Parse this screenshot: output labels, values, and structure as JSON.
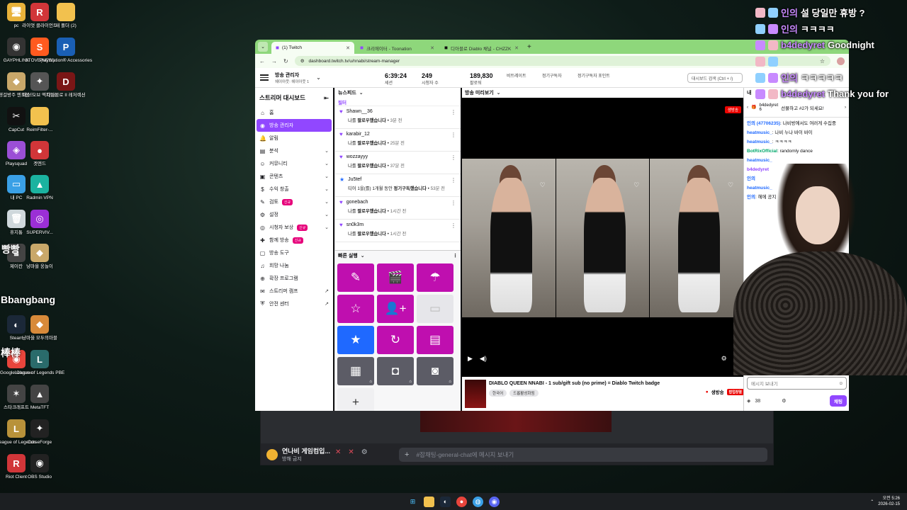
{
  "desktop": {
    "icons": [
      {
        "label": "pc",
        "glyph": "🖥",
        "color": "#e8b23a"
      },
      {
        "label": "라이엇 클라이언트",
        "glyph": "R",
        "color": "#d13639"
      },
      {
        "label": "새 폴더 (2)",
        "glyph": "",
        "color": "#f2c14e"
      },
      {
        "label": "GAYPHLINK",
        "glyph": "◉",
        "color": "#333"
      },
      {
        "label": "STOVE(NEW)",
        "glyph": "S",
        "color": "#ff5a1f"
      },
      {
        "label": "PlayStation® Accessories",
        "glyph": "P",
        "color": "#1a5fb4"
      },
      {
        "label": "영걸방주 엔드필드",
        "glyph": "◆",
        "color": "#c9a86a"
      },
      {
        "label": "패스 오브 엑자일2",
        "glyph": "✦",
        "color": "#555"
      },
      {
        "label": "디아블로 II 레저렉션",
        "glyph": "D",
        "color": "#7a1616"
      },
      {
        "label": "CapCut",
        "glyph": "✂",
        "color": "#111"
      },
      {
        "label": "ReimFilter-...",
        "glyph": "",
        "color": "#f2c14e"
      },
      {
        "label": "Playsquad",
        "glyph": "◈",
        "color": "#9b4fd6"
      },
      {
        "label": "겟엔드",
        "glyph": "●",
        "color": "#d13639"
      },
      {
        "label": "내 PC",
        "glyph": "▭",
        "color": "#3aa0e6"
      },
      {
        "label": "Radmin VPN",
        "glyph": "▲",
        "color": "#1bb3a0"
      },
      {
        "label": "휴지통",
        "glyph": "🗑",
        "color": "#cfd8dc"
      },
      {
        "label": "SUPERVIV...",
        "glyph": "◎",
        "color": "#9b2fd6"
      },
      {
        "label": "제이칸",
        "glyph": "■",
        "color": "#444"
      },
      {
        "label": "냥마을 웅놀이",
        "glyph": "◆",
        "color": "#c9a86a"
      },
      {
        "label": "Steam",
        "glyph": "◐",
        "color": "#1b2838"
      },
      {
        "label": "냥마을 모두의마블",
        "glyph": "◆",
        "color": "#d88a3a"
      },
      {
        "label": "Google Chrome",
        "glyph": "◉",
        "color": "#e8453c"
      },
      {
        "label": "League of Legends PBE",
        "glyph": "L",
        "color": "#2a6b6b"
      },
      {
        "label": "스타크래프트",
        "glyph": "✶",
        "color": "#444"
      },
      {
        "label": "MetaTFT",
        "glyph": "▲",
        "color": "#444"
      },
      {
        "label": "League of Legends",
        "glyph": "L",
        "color": "#b8923a"
      },
      {
        "label": "CurseForge",
        "glyph": "✦",
        "color": "#222"
      },
      {
        "label": "Riot Client",
        "glyph": "R",
        "color": "#d13639"
      },
      {
        "label": "OBS Studio",
        "glyph": "◉",
        "color": "#222"
      }
    ],
    "big_label_1": "빵빵",
    "big_label_2": "Bbangbang",
    "big_label_3": "棒棒"
  },
  "discord": {
    "username": "연나비 게임컴입...",
    "user_status": "방해 금지",
    "chat_placeholder": "#잡채팅-general-chat에 메시지 보내기"
  },
  "browser": {
    "tabs": [
      {
        "title": "(1) Twitch",
        "active": true
      },
      {
        "title": "크리에이터 - Toonation",
        "active": false
      },
      {
        "title": "디아블로 Diablo 채널 - CHZZK",
        "active": false
      }
    ],
    "url": "dashboard.twitch.tv/u/nnabi/stream-manager"
  },
  "twitch": {
    "channel_title": "방송 관리자",
    "channel_sub": "쉐이아웃: 쉐이아웃 1",
    "stats": [
      {
        "value": "6:39:24",
        "label": "세션"
      },
      {
        "value": "249",
        "label": "시청자 수"
      },
      {
        "value": "189,830",
        "label": "팔로워"
      },
      {
        "value": "",
        "label": "비트레이트"
      },
      {
        "value": "",
        "label": "정기구독자"
      },
      {
        "value": "",
        "label": "정기구독자 포인트"
      }
    ],
    "search_placeholder": "대시보드 검색 (Ctrl + /)",
    "sidebar_title": "스트리머 대시보드",
    "sidebar": [
      {
        "icon": "⌂",
        "label": "홈",
        "chev": "",
        "new": false,
        "ext": false,
        "active": false
      },
      {
        "icon": "◉",
        "label": "방송 관리자",
        "chev": "",
        "new": false,
        "ext": false,
        "active": true
      },
      {
        "icon": "🔔",
        "label": "알림",
        "chev": "",
        "new": false,
        "ext": false,
        "active": false
      },
      {
        "icon": "▤",
        "label": "분석",
        "chev": "⌄",
        "new": false,
        "ext": false,
        "active": false
      },
      {
        "icon": "☺",
        "label": "커뮤니티",
        "chev": "⌄",
        "new": false,
        "ext": false,
        "active": false
      },
      {
        "icon": "▣",
        "label": "콘텐츠",
        "chev": "⌄",
        "new": false,
        "ext": false,
        "active": false
      },
      {
        "icon": "$",
        "label": "수익 창출",
        "chev": "⌄",
        "new": false,
        "ext": false,
        "active": false
      },
      {
        "icon": "✎",
        "label": "검토",
        "chev": "⌄",
        "new": true,
        "ext": false,
        "active": false
      },
      {
        "icon": "⚙",
        "label": "설정",
        "chev": "⌄",
        "new": false,
        "ext": false,
        "active": false
      },
      {
        "icon": "◎",
        "label": "시청자 보상",
        "chev": "⌄",
        "new": true,
        "ext": false,
        "active": false
      },
      {
        "icon": "✚",
        "label": "함께 방송",
        "chev": "",
        "new": true,
        "ext": false,
        "active": false
      },
      {
        "icon": "▢",
        "label": "방송 도구",
        "chev": "",
        "new": false,
        "ext": false,
        "active": false
      },
      {
        "icon": "♫",
        "label": "희망 나눔",
        "chev": "",
        "new": false,
        "ext": false,
        "active": false
      },
      {
        "icon": "⊕",
        "label": "확장 프로그램",
        "chev": "",
        "new": false,
        "ext": false,
        "active": false
      },
      {
        "icon": "✉",
        "label": "스트리머 캠프",
        "chev": "",
        "new": false,
        "ext": true,
        "active": false
      },
      {
        "icon": "⛨",
        "label": "안전 센터",
        "chev": "",
        "new": false,
        "ext": true,
        "active": false
      }
    ],
    "new_badge": "신규",
    "feed_title": "뉴스피드",
    "feed_filter": "필터",
    "feed": [
      {
        "name": "Shawn__36",
        "action": "나를 ",
        "bold": "팔로우했습니다",
        "time": "3분 전",
        "icon": "♥"
      },
      {
        "name": "karabir_12",
        "action": "나를 ",
        "bold": "팔로우했습니다",
        "time": "25분 전",
        "icon": "♥"
      },
      {
        "name": "wozzayyy",
        "action": "나를 ",
        "bold": "팔로우했습니다",
        "time": "37분 전",
        "icon": "♥"
      },
      {
        "name": "Ju5tef",
        "action": "티어 1을(를) 1개월 동안 ",
        "bold": "정기구독했습니다",
        "time": "53분 전",
        "icon": "★"
      },
      {
        "name": "gonebach",
        "action": "나를 ",
        "bold": "팔로우했습니다",
        "time": "1시간 전",
        "icon": "♥"
      },
      {
        "name": "sn0k3m",
        "action": "나를 ",
        "bold": "팔로우했습니다",
        "time": "1시간 전",
        "icon": "♥"
      }
    ],
    "quick_title": "빠른 실행",
    "quick_actions": [
      {
        "glyph": "✎",
        "style": ""
      },
      {
        "glyph": "🎬",
        "style": ""
      },
      {
        "glyph": "☂",
        "style": ""
      },
      {
        "glyph": "☆",
        "style": ""
      },
      {
        "glyph": "👤+",
        "style": ""
      },
      {
        "glyph": "▭",
        "style": "disabled"
      },
      {
        "glyph": "★",
        "style": "blue"
      },
      {
        "glyph": "↻",
        "style": ""
      },
      {
        "glyph": "▤",
        "style": ""
      },
      {
        "glyph": "▦",
        "style": "gray"
      },
      {
        "glyph": "◘",
        "style": "gray"
      },
      {
        "glyph": "◙",
        "style": "gray"
      },
      {
        "glyph": "+",
        "style": "white"
      }
    ],
    "preview_title": "방송 미리보기",
    "live_label": "생방송",
    "stream_title": "DIABLO QUEEN NNABI - 1 sub/gift sub (no prime) = Diablo Twitch badge",
    "stream_tags": [
      "한국어",
      "드롭활성화됨"
    ],
    "live_status": "생방송",
    "popup_label": "팝업창열"
  },
  "chat": {
    "gift_text": "선물하고 #2가 되세요!",
    "gift_user": "b4dedyret",
    "gift_count": "6",
    "lines": [
      {
        "name": "인의 (47706235)",
        "text": ": 나비방에서도 여러게 수집중",
        "cls": ""
      },
      {
        "name": "heatmusic_",
        "text": ": 나비 누나 바이 바이",
        "cls": ""
      },
      {
        "name": "heatmusic_",
        "text": ": ㅋㅋㅋㅋ",
        "cls": ""
      },
      {
        "name": "BotRixOfficial",
        "text": ": randomly dance",
        "cls": "g"
      },
      {
        "name": "heatmusic_",
        "text": "",
        "cls": ""
      },
      {
        "name": "b4dedyret",
        "text": "",
        "cls": "p"
      },
      {
        "name": "인의",
        "text": "",
        "cls": ""
      },
      {
        "name": "heatmusic_",
        "text": "",
        "cls": ""
      },
      {
        "name": "인의",
        "text": ": 헤에 공지",
        "cls": ""
      }
    ],
    "input_placeholder": "메시지 보내기",
    "points": "38",
    "send_label": "채팅"
  },
  "overlay_chat": [
    {
      "name": "인의",
      "text": "설 당일만 휴방 ?"
    },
    {
      "name": "인의",
      "text": "ㅋㅋㅋㅋ"
    },
    {
      "name": "b4dedyret",
      "text": "Goodnight"
    },
    {
      "name": "",
      "text": ""
    },
    {
      "name": "인의",
      "text": "ㅋㅋㅋㅋㅋ"
    },
    {
      "name": "b4dedyret",
      "text": "Thank you for"
    }
  ],
  "taskbar": {
    "time": "오전 5:26",
    "date": "2026-02-15"
  }
}
